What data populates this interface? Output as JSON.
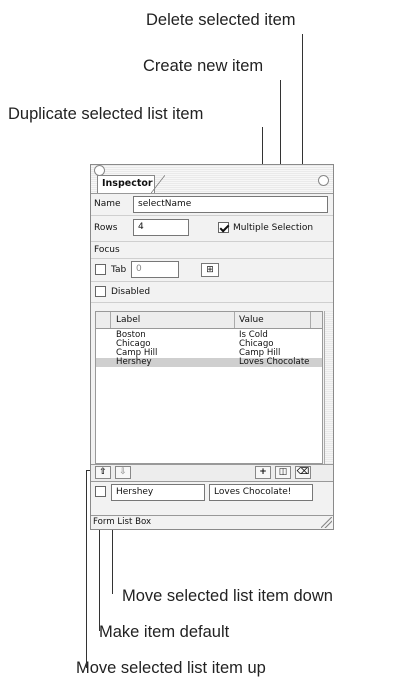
{
  "callouts": {
    "delete_selected": "Delete selected item",
    "create_new": "Create new item",
    "duplicate_selected": "Duplicate selected list item",
    "move_down": "Move selected list item down",
    "make_default": "Make item default",
    "move_up": "Move selected list item up"
  },
  "inspector": {
    "tab_label": "Inspector",
    "name_label": "Name",
    "name_value": "selectName",
    "rows_label": "Rows",
    "rows_value": "4",
    "multiple_selection_label": "Multiple Selection",
    "multiple_selection_checked": true,
    "focus_label": "Focus",
    "tab_checkbox_label": "Tab",
    "tab_value": "0",
    "tab_grid_icon": "grid-icon",
    "disabled_label": "Disabled",
    "list": {
      "columns": [
        "Label",
        "Value"
      ],
      "rows": [
        {
          "label": "Boston",
          "value": "Is Cold"
        },
        {
          "label": "Chicago",
          "value": "Chicago"
        },
        {
          "label": "Camp Hill",
          "value": "Camp Hill"
        },
        {
          "label": "Hershey",
          "value": "Loves Chocolate"
        }
      ],
      "selected_index": 3
    },
    "toolbar": {
      "up_icon": "arrow-up-icon",
      "down_icon": "arrow-down-icon",
      "add_icon": "plus-icon",
      "duplicate_icon": "duplicate-icon",
      "delete_icon": "trash-icon"
    },
    "edit_label_value": "Hershey",
    "edit_value_value": "Loves Chocolate!",
    "status_text": "Form List Box"
  }
}
